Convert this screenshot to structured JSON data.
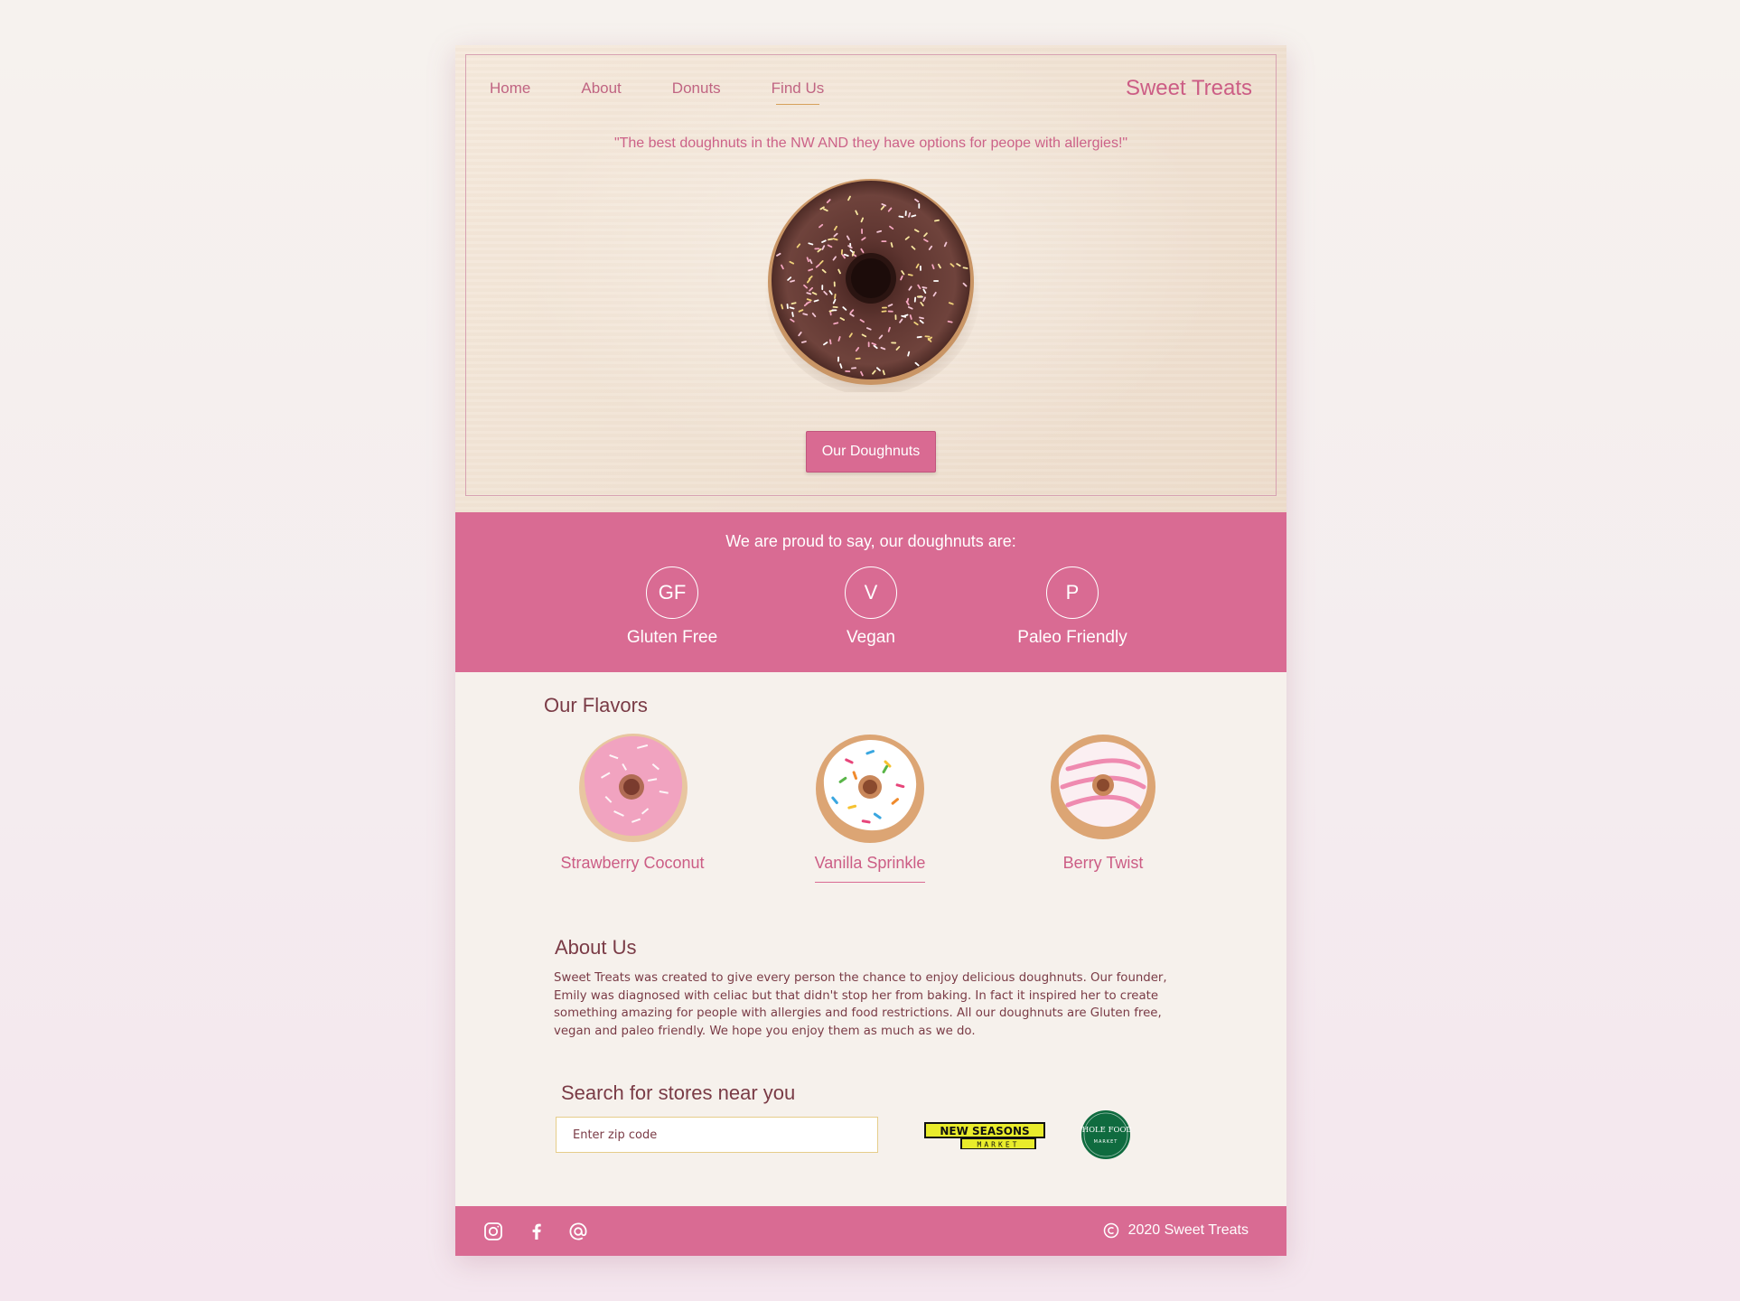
{
  "nav": {
    "items": [
      {
        "label": "Home"
      },
      {
        "label": "About"
      },
      {
        "label": "Donuts"
      },
      {
        "label": "Find Us"
      }
    ],
    "active": "Find Us",
    "brand": "Sweet Treats"
  },
  "hero": {
    "quote": "\"The best doughnuts in the NW AND they have options for peope with allergies!\"",
    "button_label": "Our Doughnuts"
  },
  "features": {
    "title": "We are proud to say, our doughnuts are:",
    "items": [
      {
        "badge": "GF",
        "label": "Gluten Free"
      },
      {
        "badge": "V",
        "label": "Vegan"
      },
      {
        "badge": "P",
        "label": "Paleo Friendly"
      }
    ]
  },
  "flavors": {
    "title": "Our Flavors",
    "items": [
      {
        "label": "Strawberry Coconut"
      },
      {
        "label": "Vanilla Sprinkle"
      },
      {
        "label": "Berry Twist"
      }
    ],
    "active": "Vanilla Sprinkle"
  },
  "about": {
    "title": "About Us",
    "text": "Sweet Treats was created to give every person the chance to enjoy delicious doughnuts. Our founder, Emily was diagnosed with celiac but that didn't stop her from baking. In fact it inspired her to create something amazing for people with allergies and food restrictions. All our doughnuts are Gluten free, vegan and paleo friendly. We hope you enjoy them as much as we do."
  },
  "search": {
    "title": "Search for stores near you",
    "placeholder": "Enter zip code",
    "stores": [
      {
        "name": "NEW SEASONS",
        "sub": "MARKET"
      },
      {
        "name": "WHOLE FOODS",
        "sub": "MARKET"
      }
    ]
  },
  "footer": {
    "social_icons": [
      "instagram-icon",
      "facebook-icon",
      "at-sign-icon"
    ],
    "copyright": "2020 Sweet Treats"
  },
  "colors": {
    "brand_pink": "#d96b93",
    "text_maroon": "#7a3b46",
    "link_pink": "#cc5d85",
    "input_border": "#e6cd8a"
  }
}
